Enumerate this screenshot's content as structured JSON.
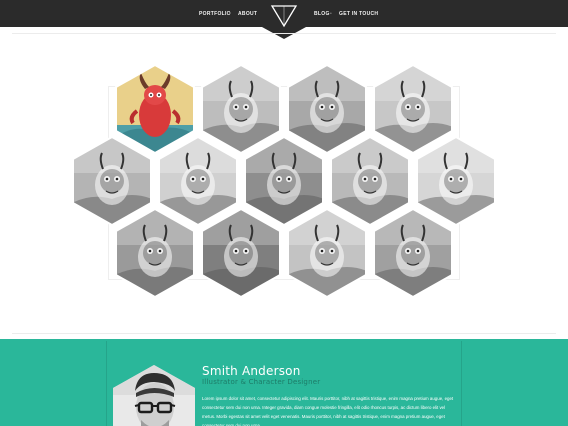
{
  "nav": {
    "left_items": [
      {
        "label": "PORTFOLIO"
      },
      {
        "label": "ABOUT"
      }
    ],
    "right_items": [
      {
        "label": "BLOG"
      },
      {
        "label": "GET IN TOUCH"
      }
    ],
    "separator": "•",
    "logo_icon": "triangle-logo-icon"
  },
  "gallery": {
    "items": [
      {
        "name": "red-horned-monster-illustration",
        "color": "colored",
        "theme": "#f0d27a"
      },
      {
        "name": "robot-creature-illustration",
        "color": "grayscale",
        "theme": "#bdbdbd"
      },
      {
        "name": "blob-monster-illustration",
        "color": "grayscale",
        "theme": "#a8a8a8"
      },
      {
        "name": "bird-creature-illustration",
        "color": "grayscale",
        "theme": "#c7c7c7"
      },
      {
        "name": "fish-creature-illustration",
        "color": "grayscale",
        "theme": "#b4b4b4"
      },
      {
        "name": "goat-creature-illustration",
        "color": "grayscale",
        "theme": "#d0d0d0"
      },
      {
        "name": "tentacle-monster-illustration",
        "color": "grayscale",
        "theme": "#8e8e8e"
      },
      {
        "name": "horned-pair-illustration",
        "color": "grayscale",
        "theme": "#b9b9b9"
      },
      {
        "name": "hooded-ghost-illustration",
        "color": "grayscale",
        "theme": "#d6d6d6"
      },
      {
        "name": "jellyfish-illustration",
        "color": "grayscale",
        "theme": "#9a9a9a"
      },
      {
        "name": "totem-mask-illustration",
        "color": "grayscale",
        "theme": "#7f7f7f"
      },
      {
        "name": "flying-fish-illustration",
        "color": "grayscale",
        "theme": "#c3c3c3"
      },
      {
        "name": "horned-island-creature-illustration",
        "color": "grayscale",
        "theme": "#a0a0a0"
      }
    ]
  },
  "profile": {
    "name": "Smith Anderson",
    "role": "Illustrator & Character Designer",
    "bio": "Lorem ipsum dolor sit amet, consectetur adipiscing elit. Mauris porttitor, nibh at sagittis tristique, enim magna pretium augue, eget consectetur sem dui non urna. Integer gravida, diam congue molestie fringilla, elit odio rhoncus turpis, ac dictum libero elit vel metus. Morbi egestas sit amet velit eget venenatis. Mauris porttitor, nibh at sagittis tristique, enim magna pretium augue, eget consectetur sem dui non urna.",
    "avatar_icon": "man-with-glasses-avatar"
  },
  "colors": {
    "nav_background": "#2b2b2b",
    "accent": "#2ab79a",
    "role_text": "#1d7c68"
  }
}
